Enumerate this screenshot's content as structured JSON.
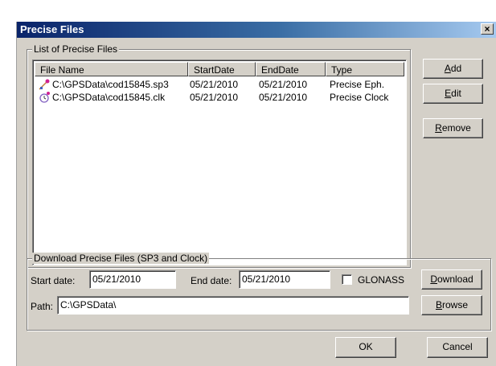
{
  "window": {
    "title": "Precise Files",
    "close_glyph": "×"
  },
  "list_group": {
    "legend": "List of Precise Files",
    "columns": [
      "File Name",
      "StartDate",
      "EndDate",
      "Type"
    ],
    "rows": [
      {
        "file_name": "C:\\GPSData\\cod15845.sp3",
        "start_date": "05/21/2010",
        "end_date": "05/21/2010",
        "type": "Precise Eph.",
        "icon": "satellite-ephemeris-icon"
      },
      {
        "file_name": "C:\\GPSData\\cod15845.clk",
        "start_date": "05/21/2010",
        "end_date": "05/21/2010",
        "type": "Precise Clock",
        "icon": "satellite-clock-icon"
      }
    ]
  },
  "side_buttons": {
    "add": {
      "pre": "",
      "key": "A",
      "post": "dd"
    },
    "edit": {
      "pre": "",
      "key": "E",
      "post": "dit"
    },
    "remove": {
      "pre": "",
      "key": "R",
      "post": "emove"
    }
  },
  "download_group": {
    "legend": "Download Precise Files (SP3 and Clock)",
    "start_label": "Start date:",
    "start_value": "05/21/2010",
    "end_label": "End date:",
    "end_value": "05/21/2010",
    "glonass_label": "GLONASS",
    "glonass_checked": false,
    "download": {
      "pre": "",
      "key": "D",
      "post": "ownload"
    },
    "path_label": "Path:",
    "path_value": "C:\\GPSData\\",
    "browse": {
      "pre": "",
      "key": "B",
      "post": "rowse"
    }
  },
  "footer": {
    "ok_label": "OK",
    "cancel_label": "Cancel"
  }
}
